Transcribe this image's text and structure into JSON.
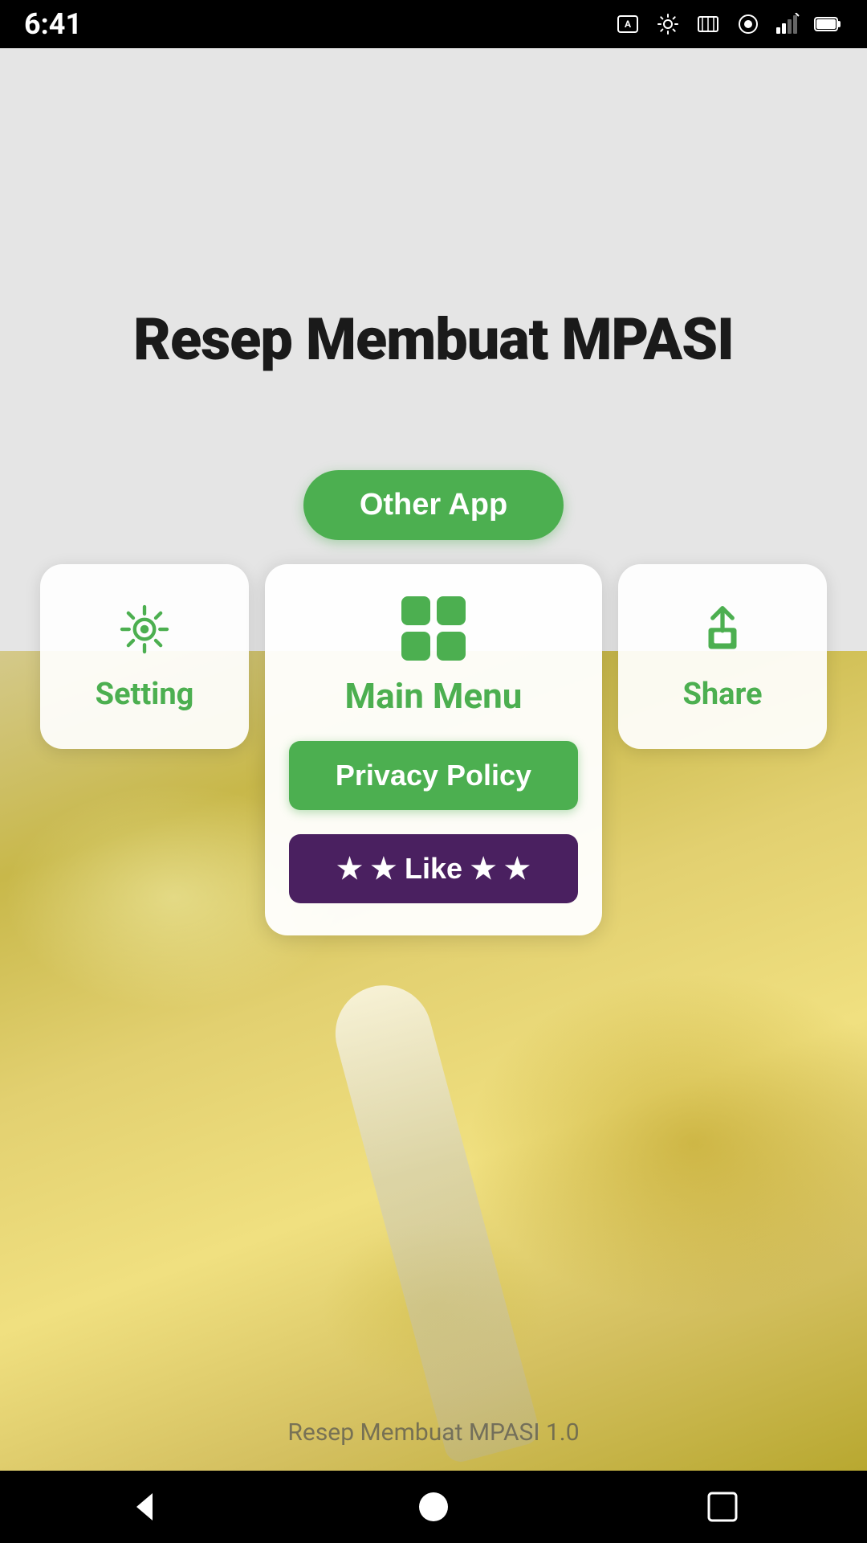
{
  "statusBar": {
    "time": "6:41",
    "icons": [
      "text-icon",
      "settings-dot-icon",
      "memory-icon",
      "circle-arrow-icon",
      "signal-icon",
      "battery-icon"
    ]
  },
  "appTitle": "Resep Membuat MPASI",
  "otherAppButton": "Other App",
  "cards": {
    "setting": {
      "label": "Setting",
      "icon": "gear-icon"
    },
    "mainMenu": {
      "label": "Main Menu",
      "icon": "grid-icon",
      "privacyPolicy": "Privacy Policy",
      "like": "★ ★ Like ★ ★"
    },
    "share": {
      "label": "Share",
      "icon": "share-icon"
    }
  },
  "versionText": "Resep Membuat MPASI 1.0",
  "navBar": {
    "back": "◀",
    "home": "⬤",
    "recent": "▪"
  },
  "colors": {
    "green": "#4caf50",
    "purple": "#4a2060",
    "white": "#ffffff",
    "black": "#000000"
  }
}
